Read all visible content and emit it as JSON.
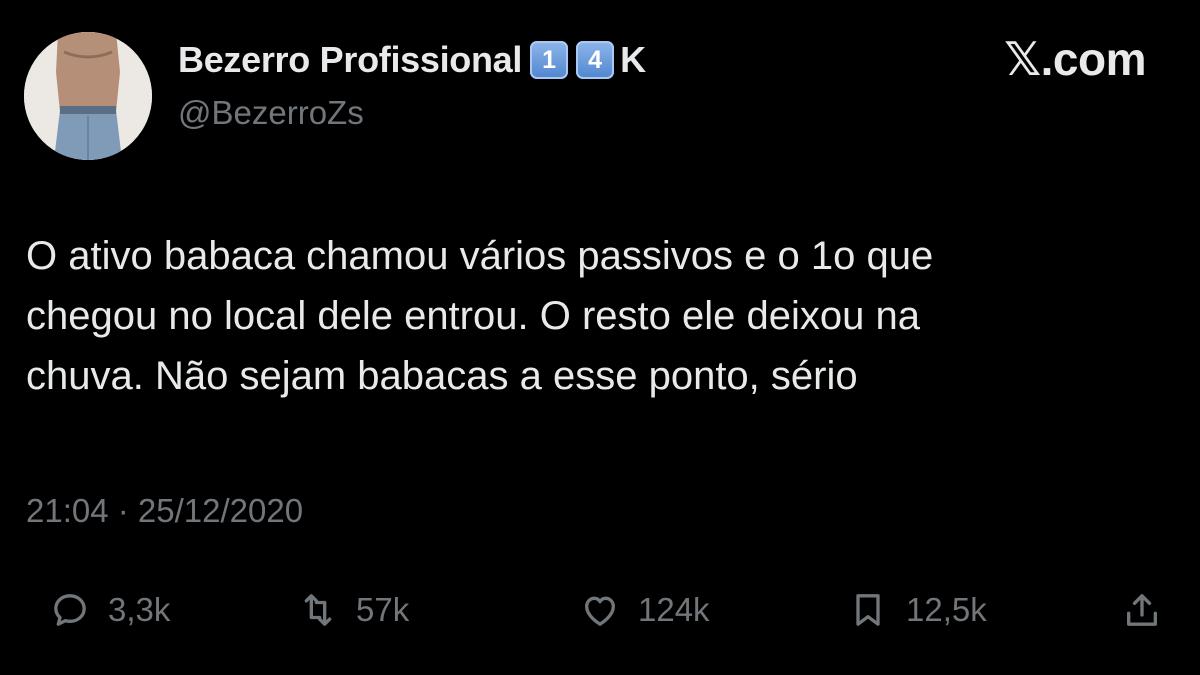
{
  "profile": {
    "display_name": "Bezerro Profissional",
    "badge_keycaps": [
      "1",
      "4"
    ],
    "badge_suffix": "K",
    "handle": "@BezerroZs",
    "avatar_icon": "avatar-photo"
  },
  "brand": "𝕏.com",
  "tweet": {
    "text_lines": [
      "O ativo babaca chamou vários passivos e o 1o que",
      "chegou no local dele entrou. O resto ele deixou na",
      "chuva. Não sejam babacas a esse ponto, sério"
    ],
    "timestamp": "21:04 · 25/12/2020"
  },
  "actions": {
    "reply": {
      "icon": "reply-icon",
      "count": "3,3k"
    },
    "retweet": {
      "icon": "retweet-icon",
      "count": "57k"
    },
    "like": {
      "icon": "heart-icon",
      "count": "124k"
    },
    "bookmark": {
      "icon": "bookmark-icon",
      "count": "12,5k"
    },
    "share": {
      "icon": "share-icon"
    }
  },
  "colors": {
    "background": "#000000",
    "primary_text": "#e7e9ea",
    "secondary_text": "#71767b"
  }
}
